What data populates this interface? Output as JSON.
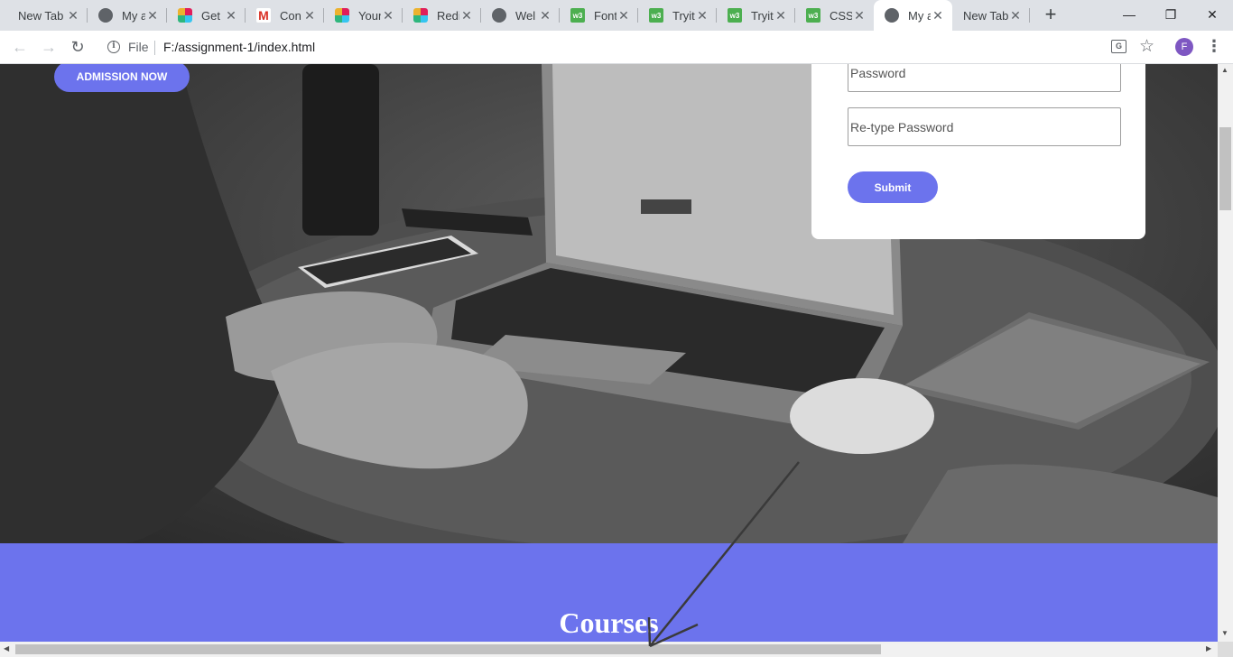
{
  "browser": {
    "tabs": [
      {
        "title": "New Tab",
        "icon": "none",
        "active": false
      },
      {
        "title": "My a",
        "icon": "globe-icon",
        "active": false
      },
      {
        "title": "Get S",
        "icon": "slack-icon",
        "active": false
      },
      {
        "title": "Con",
        "icon": "gmail-icon",
        "active": false
      },
      {
        "title": "Your",
        "icon": "slack-icon",
        "active": false
      },
      {
        "title": "Redi",
        "icon": "slack-icon",
        "active": false
      },
      {
        "title": "Wel",
        "icon": "globe-icon",
        "active": false
      },
      {
        "title": "Font",
        "icon": "w3schools-icon",
        "active": false
      },
      {
        "title": "Tryit",
        "icon": "w3schools-icon",
        "active": false
      },
      {
        "title": "Tryit",
        "icon": "w3schools-icon",
        "active": false
      },
      {
        "title": "CSS",
        "icon": "w3schools-icon",
        "active": false
      },
      {
        "title": "My a",
        "icon": "globe-icon",
        "active": true
      },
      {
        "title": "New Tab",
        "icon": "none",
        "active": false
      }
    ],
    "new_tab_glyph": "+",
    "window_controls": {
      "minimize": "—",
      "maximize": "❐",
      "close": "✕"
    },
    "scheme_label": "File",
    "url": "F:/assignment-1/index.html",
    "profile_initial": "F",
    "translate_glyph": "G",
    "w3_glyph": "w3",
    "gmail_glyph": "M",
    "tab_close_glyph": "✕",
    "back_glyph": "←",
    "forward_glyph": "→",
    "reload_glyph": "↻",
    "info_glyph": "i",
    "star_glyph": "☆",
    "menu_glyph": "⋮"
  },
  "page": {
    "admission_button_label": "ADMISSION NOW",
    "form": {
      "password_placeholder": "Password",
      "retype_placeholder": "Re-type Password",
      "submit_label": "Submit"
    },
    "courses_heading": "Courses"
  },
  "colors": {
    "accent": "#6c73ed",
    "tabstrip": "#dee1e6",
    "hero_dark": "#3e3e3e"
  }
}
